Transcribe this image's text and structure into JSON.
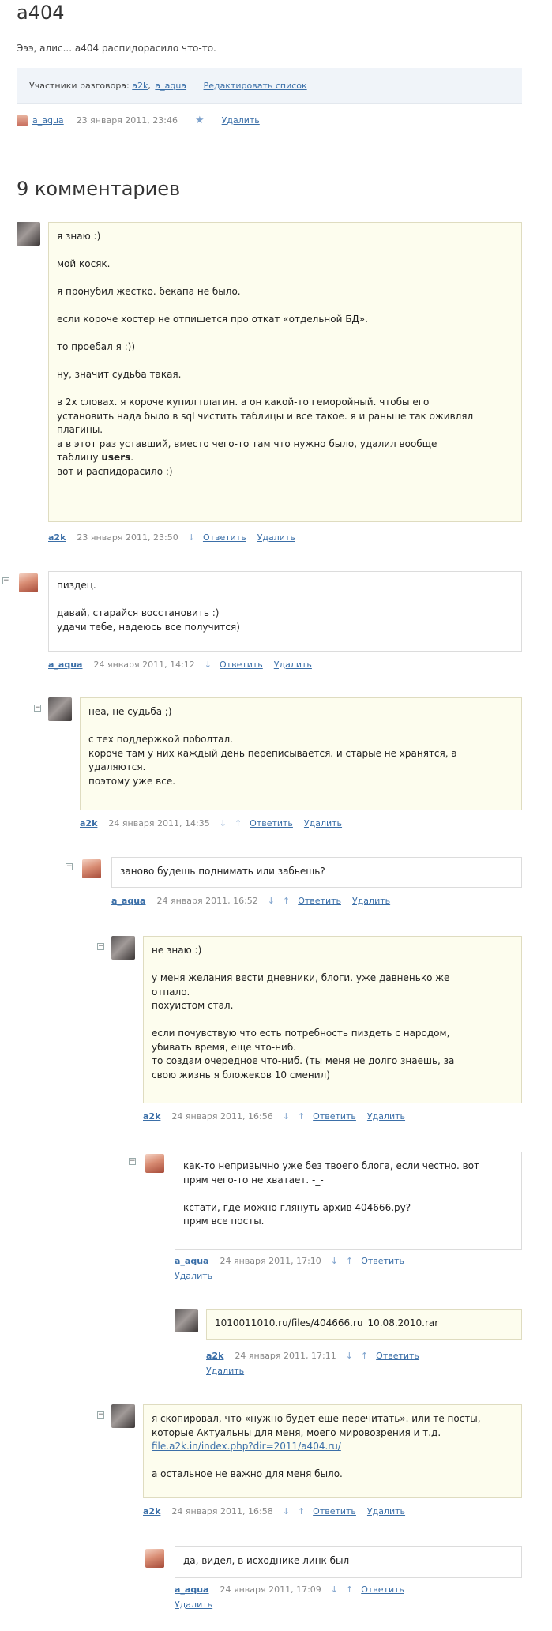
{
  "post": {
    "title": "a404",
    "intro": "Эээ, алис... а404 распидорасило что-то.",
    "participants_label": "Участники разговора:",
    "participants": [
      "a2k",
      "a_aqua"
    ],
    "edit_list": "Редактировать список",
    "author": "a_aqua",
    "date": "23 января 2011, 23:46",
    "star": "★",
    "delete": "Удалить"
  },
  "comments_title": "9 комментариев",
  "labels": {
    "reply": "Ответить",
    "delete": "Удалить",
    "down": "↓",
    "up": "↑",
    "collapse": "−"
  },
  "comments": [
    {
      "author": "a2k",
      "date": "23 января 2011, 23:50",
      "lines": [
        "я знаю :)",
        "",
        "мой косяк.",
        "",
        "я пронубил жестко. бекапа не было.",
        "",
        "если короче хостер не отпишется про откат «отдельной БД».",
        "",
        "то проебал я :))",
        "",
        "ну, значит судьба такая.",
        "",
        "в 2х словах. я короче купил плагин. а он какой-то геморойный. чтобы его",
        "установить нада было в sql чистить таблицы и все такое. я и раньше так оживлял",
        "плагины.",
        "а в этот раз уставший, вместо чего-то там что нужно было, удалил вообще",
        "таблицу"
      ],
      "bold_word": "users",
      "last_line": "вот и распидорасило :)"
    },
    {
      "author": "a_aqua",
      "date": "24 января 2011, 14:12",
      "text": "пиздец.\n\nдавай, старайся восстановить :)\nудачи тебе, надеюсь все получится)"
    },
    {
      "author": "a2k",
      "date": "24 января 2011, 14:35",
      "text": "неа, не судьба ;)\n\nс тех поддержкой поболтал.\nкороче там у них каждый день переписывается. и старые не хранятся, а\nудаляются.\nпоэтому уже все."
    },
    {
      "author": "a_aqua",
      "date": "24 января 2011, 16:52",
      "text": "заново будешь поднимать или забьешь?"
    },
    {
      "author": "a2k",
      "date": "24 января 2011, 16:56",
      "text": "не знаю :)\n\nу меня желания вести дневники, блоги. уже давненько же\nотпало.\nпохуистом стал.\n\nесли почувствую что есть потребность пиздеть с народом,\nубивать время, еще что-ниб.\nто создам очередное что-ниб. (ты меня не долго знаешь, за\nсвою жизнь я бложеков 10 сменил)"
    },
    {
      "author": "a_aqua",
      "date": "24 января 2011, 17:10",
      "text": "как-то непривычно уже без твоего блога, если честно. вот\nпрям чего-то не хватает. -_-\n\nкстати, где можно глянуть архив 404666.ру?\nпрям все посты."
    },
    {
      "author": "a2k",
      "date": "24 января 2011, 17:11",
      "text": "1010011010.ru/files/404666.ru_10.08.2010.rar"
    },
    {
      "author": "a2k",
      "date": "24 января 2011, 16:58",
      "text_before": "я скопировал, что «нужно будет еще перечитать». или те посты,\nкоторые Актуальны для меня, моего мировозрения и т.д.",
      "link": "file.a2k.in/index.php?dir=2011/a404.ru/",
      "text_after": "а остальное не важно для меня было."
    },
    {
      "author": "a_aqua",
      "date": "24 января 2011, 17:09",
      "text": "да, видел, в исходнике линк был"
    }
  ],
  "colors": {
    "link": "#3b6fa8",
    "bubble_bg": "#fdfdee",
    "bubble_border": "#dfdcc0",
    "participants_bg": "#f0f4f9"
  }
}
